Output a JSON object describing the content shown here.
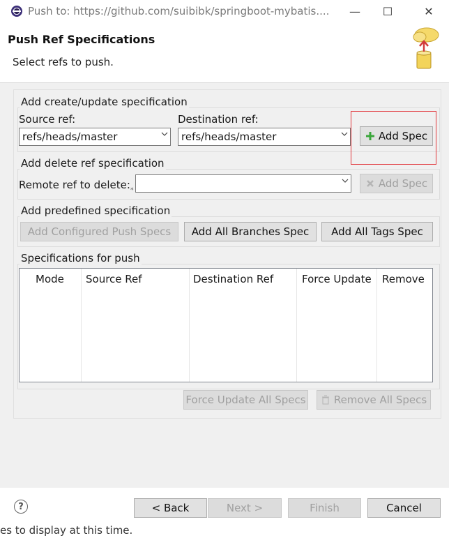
{
  "window": {
    "title": "Push to: https://github.com/suibibk/springboot-mybatis....",
    "minimize_symbol": "—",
    "maximize_symbol": "☐",
    "close_symbol": "✕"
  },
  "header": {
    "title": "Push Ref Specifications",
    "subtitle": "Select refs to push."
  },
  "create_update": {
    "group_label": "Add create/update specification",
    "source_label": "Source ref:",
    "source_value": "refs/heads/master",
    "destination_label": "Destination ref:",
    "destination_value": "refs/heads/master",
    "add_spec_label": "Add Spec"
  },
  "delete": {
    "group_label": "Add delete ref specification",
    "remote_label": "Remote ref to delete:",
    "remote_value": "",
    "add_spec_label": "Add Spec"
  },
  "predefined": {
    "group_label": "Add predefined specification",
    "configured_label": "Add Configured Push Specs",
    "branches_label": "Add All Branches Spec",
    "tags_label": "Add All Tags Spec"
  },
  "specs": {
    "group_label": "Specifications for push",
    "columns": [
      "Mode",
      "Source Ref",
      "Destination Ref",
      "Force Update",
      "Remove"
    ],
    "rows": [],
    "force_update_all_label": "Force Update All Specs",
    "remove_all_label": "Remove All Specs"
  },
  "footer": {
    "help_symbol": "?",
    "back_label": "< Back",
    "next_label": "Next >",
    "finish_label": "Finish",
    "cancel_label": "Cancel"
  },
  "background_text": "es to display at this time.",
  "colors": {
    "highlight": "#e2373c",
    "dialog_bg": "#f0f0f0",
    "add_icon": "#3aa63a"
  }
}
